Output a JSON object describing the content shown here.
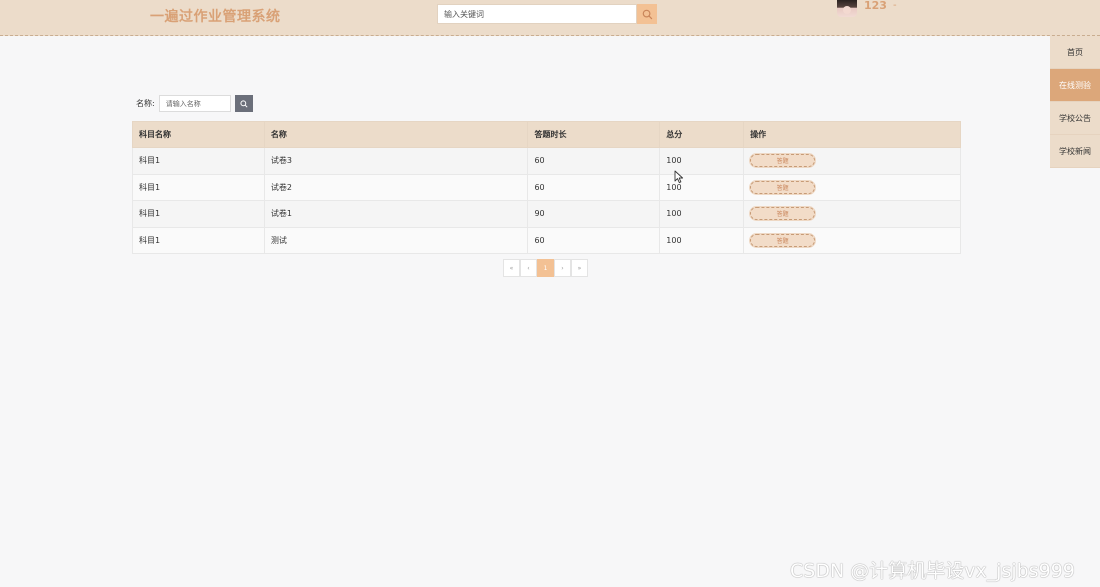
{
  "header": {
    "logo": "一遍过作业管理系统",
    "search_placeholder": "输入关键词",
    "username": "123",
    "user_caret": "-"
  },
  "side_nav": {
    "items": [
      {
        "label": "首页",
        "active": false
      },
      {
        "label": "在线测验",
        "active": true
      },
      {
        "label": "学校公告",
        "active": false
      },
      {
        "label": "学校新闻",
        "active": false
      }
    ]
  },
  "filter": {
    "label": "名称:",
    "placeholder": "请输入名称"
  },
  "table": {
    "columns": [
      "科目名称",
      "名称",
      "答题时长",
      "总分",
      "操作"
    ],
    "rows": [
      {
        "subject": "科目1",
        "name": "试卷3",
        "duration": "60",
        "score": "100",
        "action": "答题"
      },
      {
        "subject": "科目1",
        "name": "试卷2",
        "duration": "60",
        "score": "100",
        "action": "答题"
      },
      {
        "subject": "科目1",
        "name": "试卷1",
        "duration": "90",
        "score": "100",
        "action": "答题"
      },
      {
        "subject": "科目1",
        "name": "测试",
        "duration": "60",
        "score": "100",
        "action": "答题"
      }
    ]
  },
  "pagination": {
    "first": "«",
    "prev": "‹",
    "current": "1",
    "next": "›",
    "last": "»"
  },
  "watermark": "CSDN @计算机毕设vx_jsjbs999",
  "colors": {
    "header_bg": "#ecdcca",
    "accent": "#dca77a",
    "logo": "#d9a176",
    "search_button": "#f3c194"
  },
  "icons": {
    "search": "search-icon",
    "filter_search": "search-icon",
    "cursor": "mouse-cursor-icon"
  }
}
